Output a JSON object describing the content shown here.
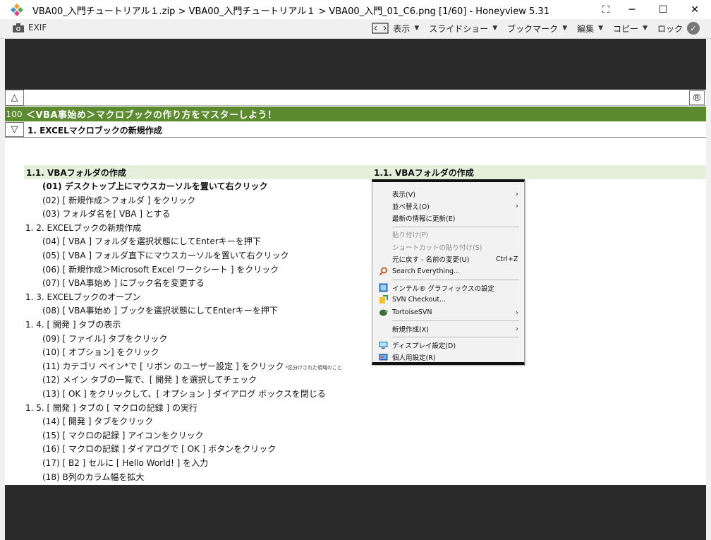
{
  "window": {
    "title": "VBA00_入門チュートリアル１.zip  >  VBA00_入門チュートリアル１  >  VBA00_入門_01_C6.png [1/60] - Honeyview 5.31",
    "minimize": "─",
    "maximize": "☐",
    "close": "✕",
    "extra": "⛶"
  },
  "toolbar": {
    "exif": "EXIF",
    "display": "表示",
    "slideshow": "スライドショー",
    "bookmark": "ブックマーク",
    "edit": "編集",
    "copy": "コピー",
    "lock": "ロック"
  },
  "sheet": {
    "up_marker": "△",
    "r_marker": "®",
    "down_marker": "▽",
    "chapter_num": "100",
    "chapter_title": "＜VBA事始め＞マクロブックの作り方をマスターしよう！",
    "section_title": "1.  EXCELマクロブックの新規作成",
    "sub_left": "1.1. VBAフォルダの作成",
    "sub_right": "1.1. VBAフォルダの作成",
    "lines": [
      {
        "text": "(01) デスクトップ上にマウスカーソルを置いて右クリック",
        "kind": "step",
        "bold": true
      },
      {
        "text": "(02) [ 新規作成＞フォルダ ] をクリック",
        "kind": "step"
      },
      {
        "text": "(03) フォルダ名を[ VBA ] とする",
        "kind": "step"
      },
      {
        "text": "1. 2. EXCELブックの新規作成",
        "kind": "head"
      },
      {
        "text": "(04) [ VBA ] フォルダを選択状態にしてEnterキーを押下",
        "kind": "step"
      },
      {
        "text": "(05) [ VBA ] フォルダ直下にマウスカーソルを置いて右クリック",
        "kind": "step"
      },
      {
        "text": "(06) [ 新規作成＞Microsoft Excel ワークシート ] をクリック",
        "kind": "step"
      },
      {
        "text": "(07) [ VBA事始め ] にブック名を変更する",
        "kind": "step"
      },
      {
        "text": "1. 3. EXCELブックのオープン",
        "kind": "head"
      },
      {
        "text": "(08) [ VBA事始め ] ブックを選択状態にしてEnterキーを押下",
        "kind": "step"
      },
      {
        "text": "1. 4. [ 開発 ] タブの表示",
        "kind": "head"
      },
      {
        "text": "(09)  [ ファイル] タブをクリック",
        "kind": "step"
      },
      {
        "text": "(10)  [ オプション] をクリック",
        "kind": "step"
      },
      {
        "text": "(11)  カテゴリ ペイン*で [ リボン のユーザー設定 ] をクリック",
        "kind": "step",
        "note": "*区分けされた領域のこと"
      },
      {
        "text": "(12)  メイン タブの一覧で、[ 開発 ] を選択してチェック",
        "kind": "step"
      },
      {
        "text": "(13)  [ OK ] をクリックして、[ オプション ] ダイアログ ボックスを閉じる",
        "kind": "step"
      },
      {
        "text": "1. 5. [ 開発 ] タブの [ マクロの記録 ] の実行",
        "kind": "head"
      },
      {
        "text": "(14) [ 開発 ] タブをクリック",
        "kind": "step"
      },
      {
        "text": "(15) [ マクロの記録 ] アイコンをクリック",
        "kind": "step"
      },
      {
        "text": "(16) [ マクロの記録 ] ダイアログで [ OK ] ボタンをクリック",
        "kind": "step"
      },
      {
        "text": "(17) [ B2 ] セルに [ Hello World! ] を入力",
        "kind": "step"
      },
      {
        "text": "(18)  B列のカラム幅を拡大",
        "kind": "step"
      }
    ]
  },
  "context_menu": {
    "items": [
      {
        "label": "表示(V)",
        "arrow": "›"
      },
      {
        "label": "並べ替え(O)",
        "arrow": "›"
      },
      {
        "label": "最新の情報に更新(E)"
      },
      {
        "sep": true
      },
      {
        "label": "貼り付け(P)",
        "disabled": true
      },
      {
        "label": "ショートカットの貼り付け(S)",
        "disabled": true
      },
      {
        "label": "元に戻す - 名前の変更(U)",
        "shortcut": "Ctrl+Z"
      },
      {
        "label": "Search Everything...",
        "icon": "search"
      },
      {
        "sep": true
      },
      {
        "label": "インテル® グラフィックスの設定",
        "icon": "intel"
      },
      {
        "label": "SVN Checkout...",
        "icon": "svn"
      },
      {
        "label": "TortoiseSVN",
        "icon": "tortoise",
        "arrow": "›"
      },
      {
        "sep": true
      },
      {
        "label": "新規作成(X)",
        "arrow": "›"
      },
      {
        "sep": true
      },
      {
        "label": "ディスプレイ設定(D)",
        "icon": "display"
      },
      {
        "label": "個人用設定(R)",
        "icon": "personal"
      }
    ]
  },
  "colors": {
    "chapter_bar": "#5b8a2f",
    "sub_band": "#e4efdc",
    "viewer_bg": "#2a2a2a"
  }
}
